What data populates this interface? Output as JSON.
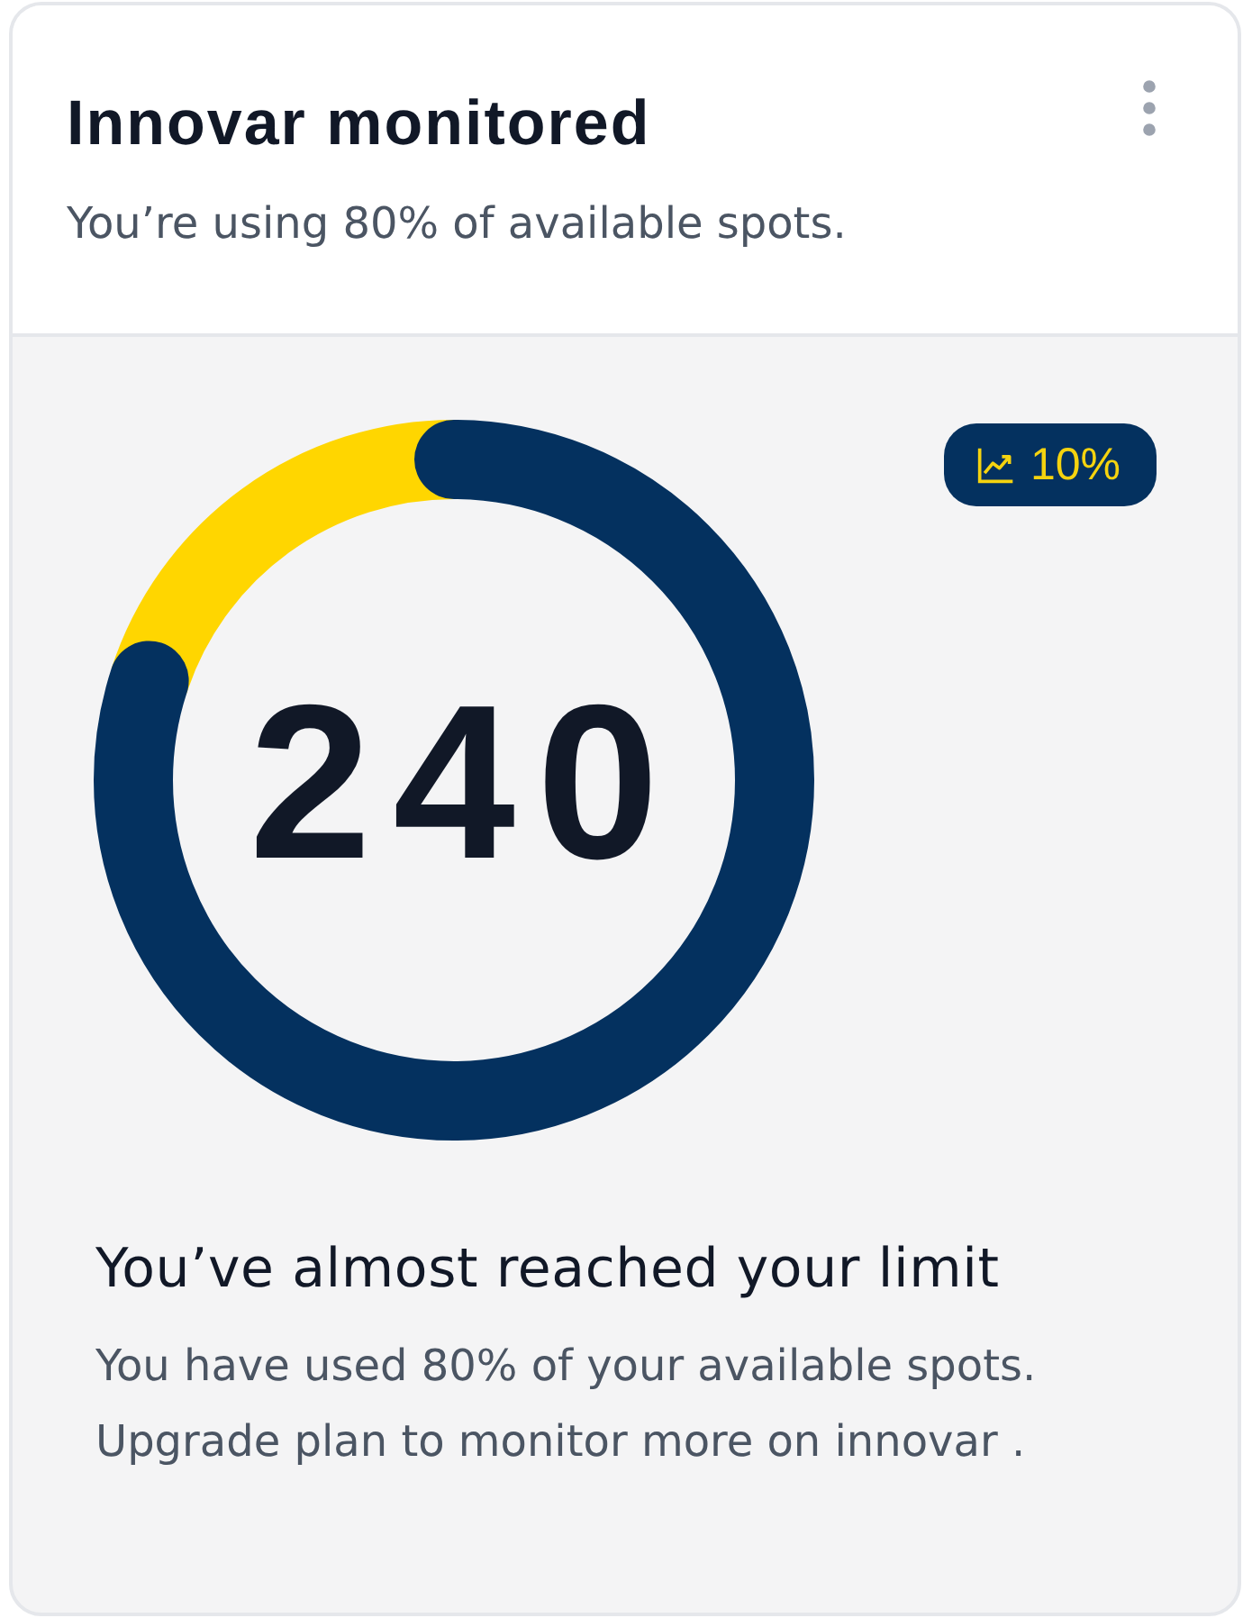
{
  "card": {
    "title": "Innovar monitored",
    "subtitle": "You’re using 80% of available spots."
  },
  "usage": {
    "level": 0.8,
    "count": "240"
  },
  "trend_badge": {
    "value": "10%"
  },
  "notice": {
    "heading": "You’ve almost reached your limit",
    "body": "You have used 80% of your available spots. Upgrade plan to monitor more on innovar ."
  }
}
